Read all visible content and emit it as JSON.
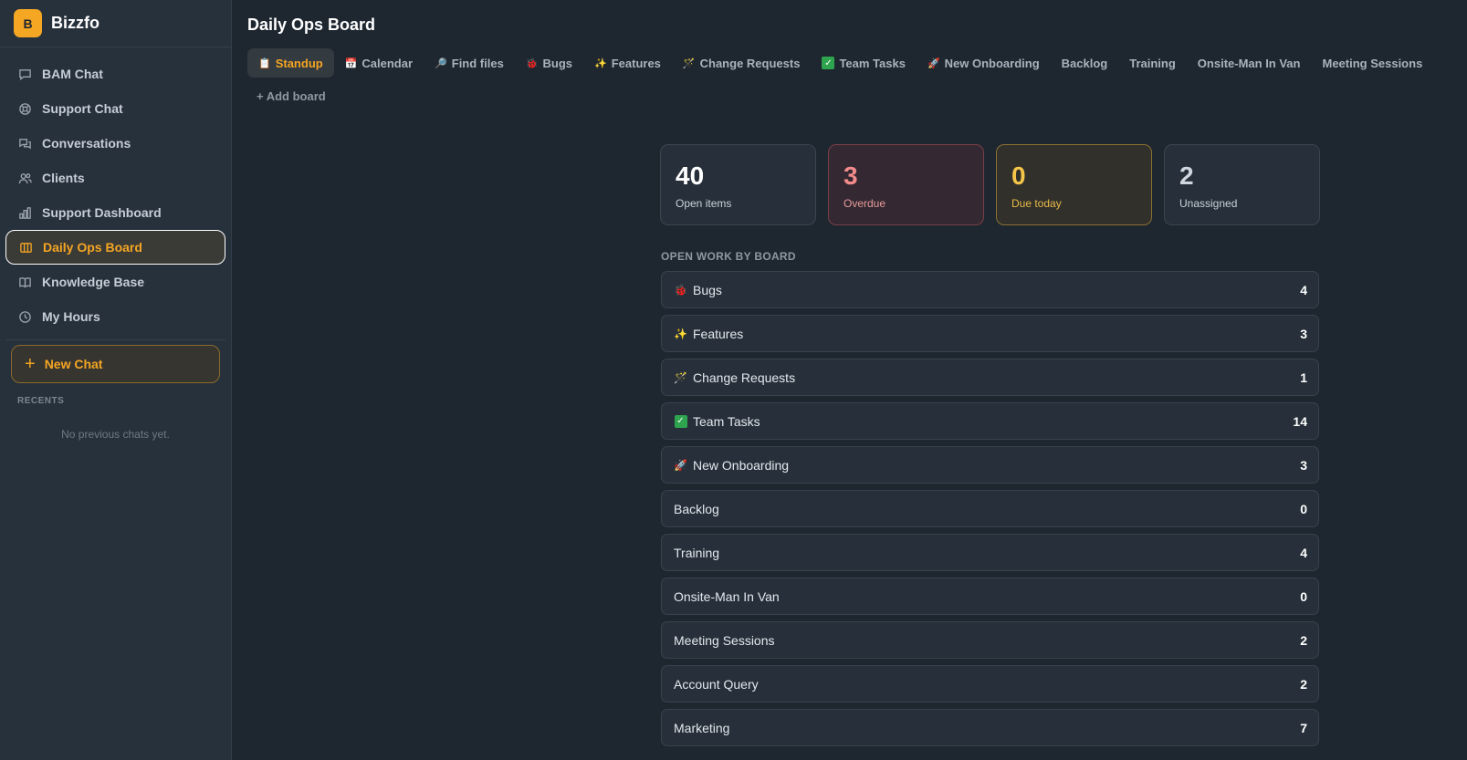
{
  "brand": {
    "logo_letter": "B",
    "name": "Bizzfo",
    "accent": "#f5a623"
  },
  "sidebar": {
    "items": [
      {
        "label": "BAM Chat",
        "icon": "chat-bubble-icon"
      },
      {
        "label": "Support Chat",
        "icon": "lifebuoy-icon"
      },
      {
        "label": "Conversations",
        "icon": "conversations-icon"
      },
      {
        "label": "Clients",
        "icon": "users-icon"
      },
      {
        "label": "Support Dashboard",
        "icon": "bar-chart-icon"
      },
      {
        "label": "Daily Ops Board",
        "icon": "board-columns-icon",
        "active": true
      },
      {
        "label": "Knowledge Base",
        "icon": "book-icon"
      },
      {
        "label": "My Hours",
        "icon": "clock-icon"
      }
    ],
    "new_chat_label": "New Chat",
    "recents_label": "RECENTS",
    "recents_empty": "No previous chats yet."
  },
  "main": {
    "title": "Daily Ops Board",
    "tabs": [
      {
        "label": "Standup",
        "icon": "📋",
        "active": true
      },
      {
        "label": "Calendar",
        "icon": "📅"
      },
      {
        "label": "Find files",
        "icon": "🔎"
      },
      {
        "label": "Bugs",
        "icon": "🐞"
      },
      {
        "label": "Features",
        "icon": "✨"
      },
      {
        "label": "Change Requests",
        "icon": "🪄"
      },
      {
        "label": "Team Tasks",
        "icon": "✅"
      },
      {
        "label": "New Onboarding",
        "icon": "🚀"
      },
      {
        "label": "Backlog",
        "icon": ""
      },
      {
        "label": "Training",
        "icon": ""
      },
      {
        "label": "Onsite-Man In Van",
        "icon": ""
      },
      {
        "label": "Meeting Sessions",
        "icon": ""
      }
    ],
    "add_board_label": "+ Add board",
    "stats": {
      "open": {
        "value": "40",
        "label": "Open items"
      },
      "overdue": {
        "value": "3",
        "label": "Overdue"
      },
      "due_today": {
        "value": "0",
        "label": "Due today"
      },
      "unassigned": {
        "value": "2",
        "label": "Unassigned"
      }
    },
    "section_label": "OPEN WORK BY BOARD",
    "boards": [
      {
        "name": "Bugs",
        "icon": "🐞",
        "count": "4"
      },
      {
        "name": "Features",
        "icon": "✨",
        "count": "3"
      },
      {
        "name": "Change Requests",
        "icon": "🪄",
        "count": "1"
      },
      {
        "name": "Team Tasks",
        "icon": "✅",
        "count": "14"
      },
      {
        "name": "New Onboarding",
        "icon": "🚀",
        "count": "3"
      },
      {
        "name": "Backlog",
        "icon": "",
        "count": "0"
      },
      {
        "name": "Training",
        "icon": "",
        "count": "4"
      },
      {
        "name": "Onsite-Man In Van",
        "icon": "",
        "count": "0"
      },
      {
        "name": "Meeting Sessions",
        "icon": "",
        "count": "2"
      },
      {
        "name": "Account Query",
        "icon": "",
        "count": "2"
      },
      {
        "name": "Marketing",
        "icon": "",
        "count": "7"
      }
    ]
  }
}
